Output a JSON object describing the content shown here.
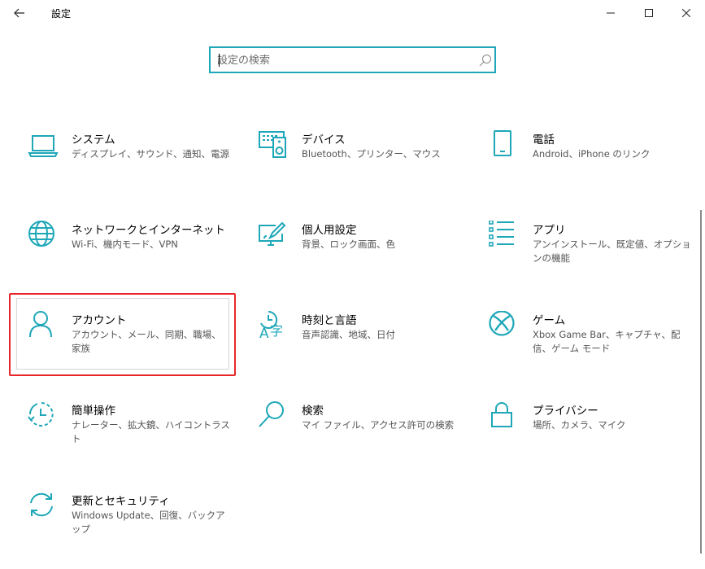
{
  "window": {
    "title": "設定",
    "buttons": [
      "minimize",
      "maximize",
      "close"
    ]
  },
  "search": {
    "placeholder": "設定の検索",
    "value": ""
  },
  "colors": {
    "accent": "#1ea7b8",
    "highlight": "#e8262a"
  },
  "tiles": [
    {
      "title": "システム",
      "desc": "ディスプレイ、サウンド、通知、電源",
      "icon": "laptop-icon"
    },
    {
      "title": "デバイス",
      "desc": "Bluetooth、プリンター、マウス",
      "icon": "devices-icon"
    },
    {
      "title": "電話",
      "desc": "Android、iPhone のリンク",
      "icon": "phone-icon"
    },
    {
      "title": "ネットワークとインターネット",
      "desc": "Wi-Fi、機内モード、VPN",
      "icon": "globe-icon"
    },
    {
      "title": "個人用設定",
      "desc": "背景、ロック画面、色",
      "icon": "personalization-icon"
    },
    {
      "title": "アプリ",
      "desc": "アンインストール、既定値、オプションの機能",
      "icon": "apps-icon"
    },
    {
      "title": "アカウント",
      "desc": "アカウント、メール、同期、職場、家族",
      "icon": "person-icon"
    },
    {
      "title": "時刻と言語",
      "desc": "音声認識、地域、日付",
      "icon": "time-language-icon"
    },
    {
      "title": "ゲーム",
      "desc": "Xbox Game Bar、キャプチャ、配信、ゲーム モード",
      "icon": "xbox-icon"
    },
    {
      "title": "簡単操作",
      "desc": "ナレーター、拡大鏡、ハイコントラスト",
      "icon": "ease-of-access-icon"
    },
    {
      "title": "検索",
      "desc": "マイ ファイル、アクセス許可の検索",
      "icon": "search-icon"
    },
    {
      "title": "プライバシー",
      "desc": "場所、カメラ、マイク",
      "icon": "lock-icon"
    },
    {
      "title": "更新とセキュリティ",
      "desc": "Windows Update、回復、バックアップ",
      "icon": "update-icon"
    }
  ]
}
